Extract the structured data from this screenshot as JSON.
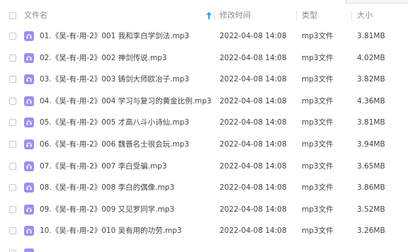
{
  "columns": {
    "name": "文件名",
    "modified": "修改时间",
    "type": "类型",
    "size": "大小"
  },
  "files": [
    {
      "name": "01.《吴-有-用-2》001 我和李白学剑法.mp3",
      "modified": "2022-04-08 14:08",
      "type": "mp3文件",
      "size": "3.81MB"
    },
    {
      "name": "02.《吴-有-用-2》002 神剑传说.mp3",
      "modified": "2022-04-08 14:08",
      "type": "mp3文件",
      "size": "4.02MB"
    },
    {
      "name": "03.《吴-有-用-2》003 铸剑大师欧冶子.mp3",
      "modified": "2022-04-08 14:08",
      "type": "mp3文件",
      "size": "3.82MB"
    },
    {
      "name": "04.《吴-有-用-2》004 学习与复习的黄金比例.mp3",
      "modified": "2022-04-08 14:08",
      "type": "mp3文件",
      "size": "4.36MB"
    },
    {
      "name": "05.《吴-有-用-2》005 才高八斗小诗仙.mp3",
      "modified": "2022-04-08 14:08",
      "type": "mp3文件",
      "size": "3.81MB"
    },
    {
      "name": "06.《吴-有-用-2》006 魏晋名士很会玩.mp3",
      "modified": "2022-04-08 14:08",
      "type": "mp3文件",
      "size": "3.94MB"
    },
    {
      "name": "07.《吴-有-用-2》007 李白受骗.mp3",
      "modified": "2022-04-08 14:08",
      "type": "mp3文件",
      "size": "3.65MB"
    },
    {
      "name": "08.《吴-有-用-2》008 李白的偶像.mp3",
      "modified": "2022-04-08 14:08",
      "type": "mp3文件",
      "size": "3.86MB"
    },
    {
      "name": "09.《吴-有-用-2》009 又见罗同学.mp3",
      "modified": "2022-04-08 14:08",
      "type": "mp3文件",
      "size": "3.52MB"
    },
    {
      "name": "10.《吴-有-用-2》010 吴有用的功劳.mp3",
      "modified": "2022-04-08 14:08",
      "type": "mp3文件",
      "size": "3.26MB"
    }
  ],
  "icons": {
    "file": "audio-file-icon",
    "sort": "sort-ascending-icon"
  },
  "colors": {
    "accent": "#1e9bf0",
    "file_icon": "#9e8ef0",
    "header_text": "#888888",
    "row_text": "#444444"
  }
}
